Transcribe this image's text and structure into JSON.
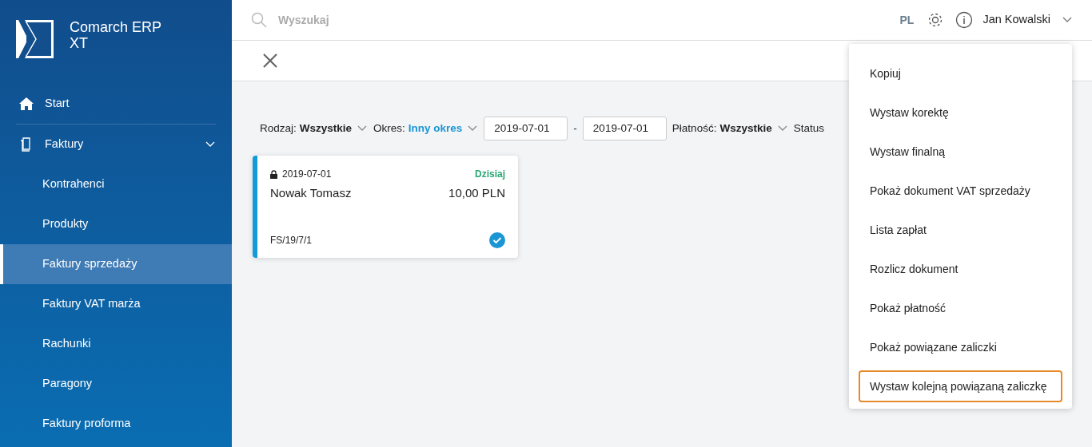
{
  "logo": {
    "line1": "Comarch ERP",
    "line2": "XT"
  },
  "sidebar": {
    "items": [
      {
        "label": "Start",
        "selected": false
      },
      {
        "label": "Faktury",
        "selected": false,
        "expanded": true,
        "children": [
          {
            "label": "Kontrahenci",
            "selected": false
          },
          {
            "label": "Produkty",
            "selected": false
          },
          {
            "label": "Faktury sprzedaży",
            "selected": true
          },
          {
            "label": "Faktury VAT marża",
            "selected": false
          },
          {
            "label": "Rachunki",
            "selected": false
          },
          {
            "label": "Paragony",
            "selected": false
          },
          {
            "label": "Faktury proforma",
            "selected": false
          }
        ]
      }
    ]
  },
  "topbar": {
    "search": {
      "placeholder": "Wyszukaj"
    },
    "language": "PL",
    "user": "Jan Kowalski"
  },
  "filters": [
    {
      "kind": "select",
      "label": "Rodzaj:",
      "value": "Wszystkie",
      "highlighted": false
    },
    {
      "kind": "select",
      "label": "Okres:",
      "value": "Inny okres",
      "highlighted": true
    },
    {
      "kind": "date",
      "value": "2019-07-01"
    },
    {
      "kind": "sep",
      "value": "-"
    },
    {
      "kind": "date",
      "value": "2019-07-01"
    },
    {
      "kind": "select",
      "label": "Płatność:",
      "value": "Wszystkie",
      "highlighted": false
    },
    {
      "kind": "text",
      "value": "Status"
    }
  ],
  "cards": [
    {
      "date": "2019-07-01",
      "locked": true,
      "due": "Dzisiaj",
      "customer": "Nowak Tomasz",
      "amount": "10,00 PLN",
      "number": "FS/19/7/1",
      "checked": true
    }
  ],
  "context_menu": [
    {
      "label": "Kopiuj",
      "focused": false
    },
    {
      "label": "Wystaw korektę",
      "focused": false
    },
    {
      "label": "Wystaw finalną",
      "focused": false
    },
    {
      "label": "Pokaż dokument VAT sprzedaży",
      "focused": false
    },
    {
      "label": "Lista zapłat",
      "focused": false
    },
    {
      "label": "Rozlicz dokument",
      "focused": false
    },
    {
      "label": "Pokaż płatność",
      "focused": false
    },
    {
      "label": "Pokaż powiązane zaliczki",
      "focused": false
    },
    {
      "label": "Wystaw kolejną powiązaną zaliczkę",
      "focused": true
    }
  ]
}
